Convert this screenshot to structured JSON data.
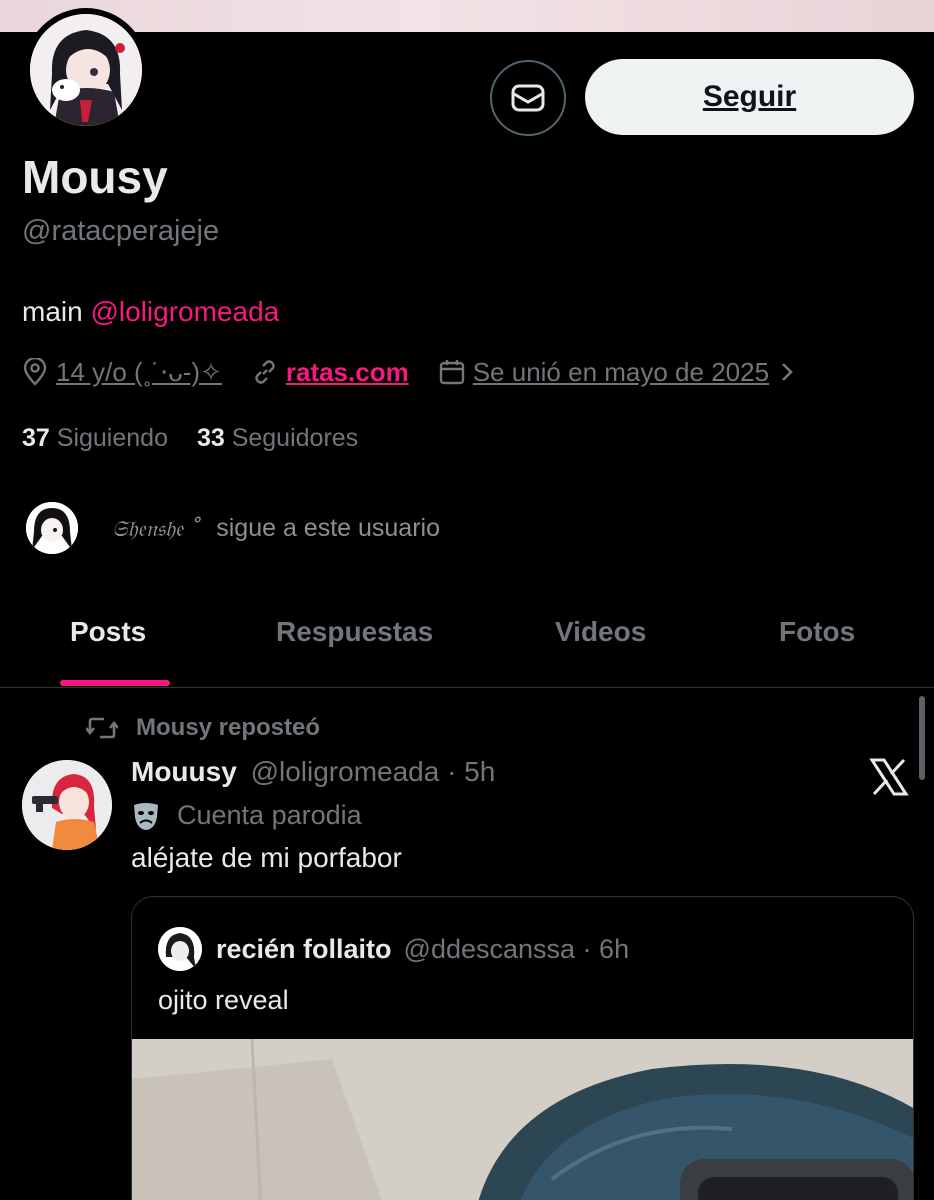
{
  "profile": {
    "display_name": "Mousy",
    "handle": "@ratacperajeje",
    "bio_prefix": "main ",
    "bio_mention": "@loligromeada",
    "location": "14 y/o (˳˙⋅ᴗ-)✧",
    "website": "ratas.com",
    "joined": "Se unió en mayo de 2025",
    "following_count": "37",
    "following_label": "Siguiendo",
    "followers_count": "33",
    "followers_label": "Seguidores",
    "followed_by_name": "𝔖𝔥𝔢𝔫𝔰𝔥𝔢 ˚",
    "followed_by_suffix": "sigue a este usuario"
  },
  "actions": {
    "follow_label": "Seguir"
  },
  "tabs": [
    {
      "label": "Posts",
      "active": true
    },
    {
      "label": "Respuestas",
      "active": false
    },
    {
      "label": "Videos",
      "active": false
    },
    {
      "label": "Fotos",
      "active": false
    }
  ],
  "feed": {
    "repost_label": "Mousy reposteó",
    "post": {
      "author_name": "Mouusy",
      "author_handle_time": "@loligromeada · 5h",
      "parody_label": "Cuenta parodia",
      "text": "aléjate de mi porfabor",
      "quote": {
        "author_name": "recién follaito",
        "author_handle_time": "@ddescanssa · 6h",
        "text": "ojito reveal"
      }
    }
  },
  "colors": {
    "accent": "#f91880",
    "background": "#000000",
    "muted_text": "#71767b",
    "primary_text": "#e7e9ea",
    "follow_button_bg": "#eff3f4"
  },
  "icons": [
    "mail-icon",
    "location-icon",
    "link-icon",
    "calendar-icon",
    "chevron-right-icon",
    "repost-icon",
    "theater-mask-icon",
    "x-logo-icon"
  ]
}
